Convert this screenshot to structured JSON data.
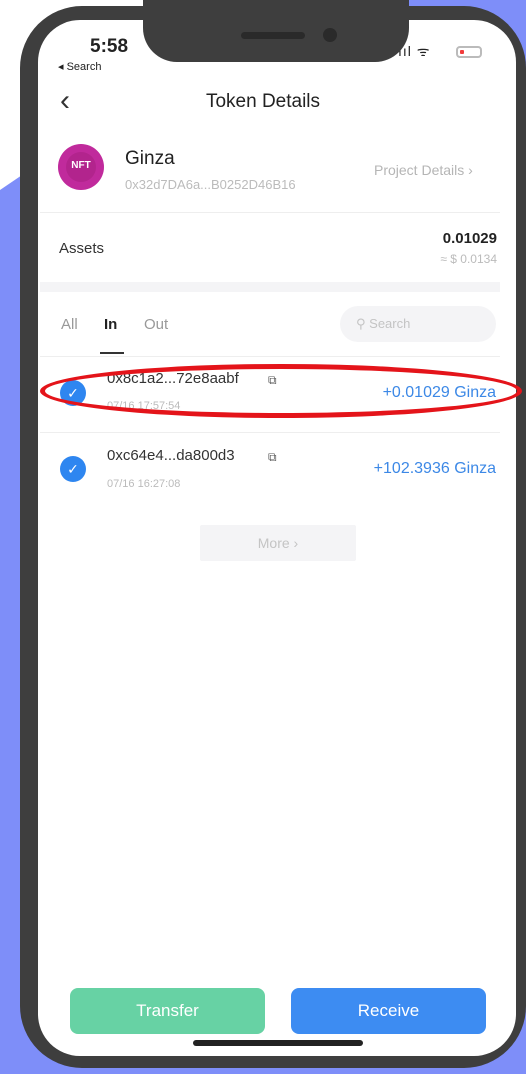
{
  "status_bar": {
    "time": "5:58",
    "back_app": "◂ Search",
    "signal_wifi": "ııl ᯤ"
  },
  "nav": {
    "title": "Token Details",
    "back_glyph": "‹"
  },
  "token": {
    "logo_text": "NFT",
    "name": "Ginza",
    "address": "0x32d7DA6a...B0252D46B16",
    "project_link": "Project Details ›"
  },
  "assets": {
    "label": "Assets",
    "amount": "0.01029",
    "usd": "≈ $ 0.0134"
  },
  "filters": {
    "tabs": [
      "All",
      "In",
      "Out"
    ],
    "active": "In",
    "search_placeholder": "Search",
    "search_glyph": "⚲"
  },
  "transactions": [
    {
      "hash": "0x8c1a2...72e8aabf",
      "date": "07/16 17:57:54",
      "amount": "+0.01029 Ginza",
      "copy_glyph": "⧉",
      "status_glyph": "✓"
    },
    {
      "hash": "0xc64e4...da800d3",
      "date": "07/16 16:27:08",
      "amount": "+102.3936 Ginza",
      "copy_glyph": "⧉",
      "status_glyph": "✓"
    }
  ],
  "more_label": "More ›",
  "actions": {
    "transfer": "Transfer",
    "receive": "Receive"
  },
  "colors": {
    "accent_blue": "#3d8cf2",
    "transfer_green": "#67d2a4",
    "highlight_red": "#e4141a",
    "background_purple": "#7e8ef9"
  }
}
